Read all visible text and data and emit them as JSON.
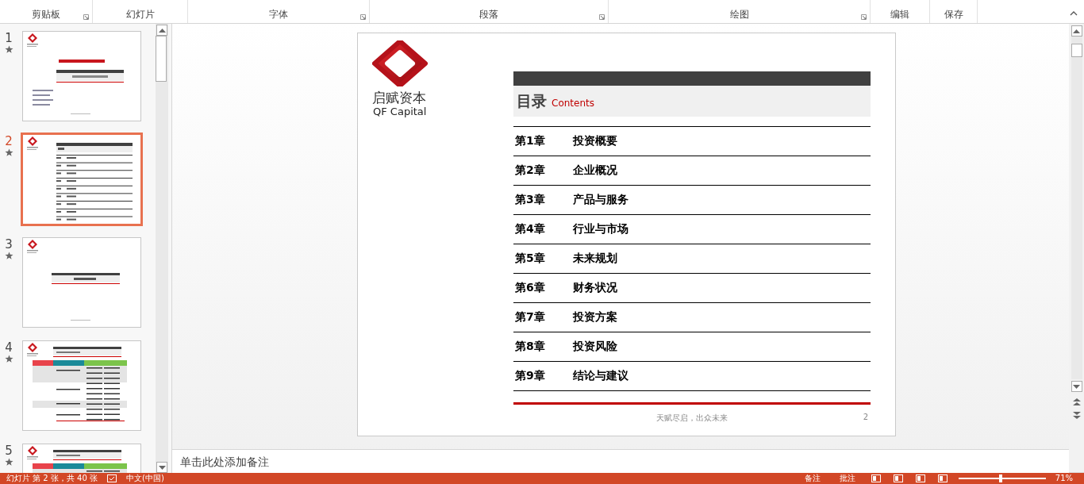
{
  "ribbon": {
    "groups": [
      {
        "label": "剪贴板",
        "launcher": true
      },
      {
        "label": "幻灯片",
        "launcher": false
      },
      {
        "label": "字体",
        "launcher": true
      },
      {
        "label": "段落",
        "launcher": true
      },
      {
        "label": "绘图",
        "launcher": true
      },
      {
        "label": "编辑",
        "launcher": false
      },
      {
        "label": "保存",
        "launcher": false
      }
    ]
  },
  "slides_panel": {
    "slides": [
      {
        "number": "1",
        "selected": false,
        "kind": "cover"
      },
      {
        "number": "2",
        "selected": true,
        "kind": "contents"
      },
      {
        "number": "3",
        "selected": false,
        "kind": "section"
      },
      {
        "number": "4",
        "selected": false,
        "kind": "table"
      },
      {
        "number": "5",
        "selected": false,
        "kind": "table"
      }
    ]
  },
  "slide": {
    "logo": {
      "name": "启赋资本",
      "subtitle": "QF Capital"
    },
    "title": "目录",
    "subtitle": "Contents",
    "chapters": [
      {
        "number": "第1章",
        "title": "投资概要"
      },
      {
        "number": "第2章",
        "title": "企业概况"
      },
      {
        "number": "第3章",
        "title": "产品与服务"
      },
      {
        "number": "第4章",
        "title": "行业与市场"
      },
      {
        "number": "第5章",
        "title": "未来规划"
      },
      {
        "number": "第6章",
        "title": "财务状况"
      },
      {
        "number": "第7章",
        "title": "投资方案"
      },
      {
        "number": "第8章",
        "title": "投资风险"
      },
      {
        "number": "第9章",
        "title": "结论与建议"
      }
    ],
    "footer": "天赋尽启，出众未来",
    "page_number": "2"
  },
  "notes": {
    "placeholder": "单击此处添加备注"
  },
  "status_bar": {
    "slide_info": "幻灯片 第 2 张，共 40 张",
    "language": "中文(中国)",
    "notes": "备注",
    "comments": "批注",
    "zoom_slider": {
      "level": 0.48
    },
    "zoom": "71%"
  }
}
